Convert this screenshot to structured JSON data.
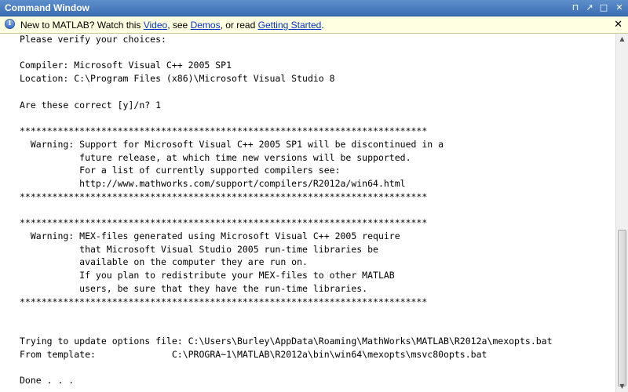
{
  "window": {
    "title": "Command Window",
    "pin_glyph": "⊓",
    "dock_glyph": "↗",
    "maximize_glyph": "□",
    "close_glyph": "✕"
  },
  "infobar": {
    "prefix": "New to MATLAB? Watch this ",
    "video_link": "Video",
    "sep1": ", see ",
    "demos_link": "Demos",
    "sep2": ", or read ",
    "getting_started_link": "Getting Started",
    "suffix": ".",
    "close_glyph": "✕"
  },
  "console": {
    "lines": [
      "Please verify your choices:",
      "",
      "Compiler: Microsoft Visual C++ 2005 SP1",
      "Location: C:\\Program Files (x86)\\Microsoft Visual Studio 8",
      "",
      "Are these correct [y]/n? 1",
      "",
      "***************************************************************************",
      "  Warning: Support for Microsoft Visual C++ 2005 SP1 will be discontinued in a",
      "           future release, at which time new versions will be supported.",
      "           For a list of currently supported compilers see:",
      "           http://www.mathworks.com/support/compilers/R2012a/win64.html",
      "***************************************************************************",
      "",
      "***************************************************************************",
      "  Warning: MEX-files generated using Microsoft Visual C++ 2005 require",
      "           that Microsoft Visual Studio 2005 run-time libraries be",
      "           available on the computer they are run on.",
      "           If you plan to redistribute your MEX-files to other MATLAB",
      "           users, be sure that they have the run-time libraries.",
      "***************************************************************************",
      "",
      "",
      "Trying to update options file: C:\\Users\\Burley\\AppData\\Roaming\\MathWorks\\MATLAB\\R2012a\\mexopts.bat",
      "From template:              C:\\PROGRA~1\\MATLAB\\R2012a\\bin\\win64\\mexopts\\msvc80opts.bat",
      "",
      "Done . . ."
    ]
  }
}
